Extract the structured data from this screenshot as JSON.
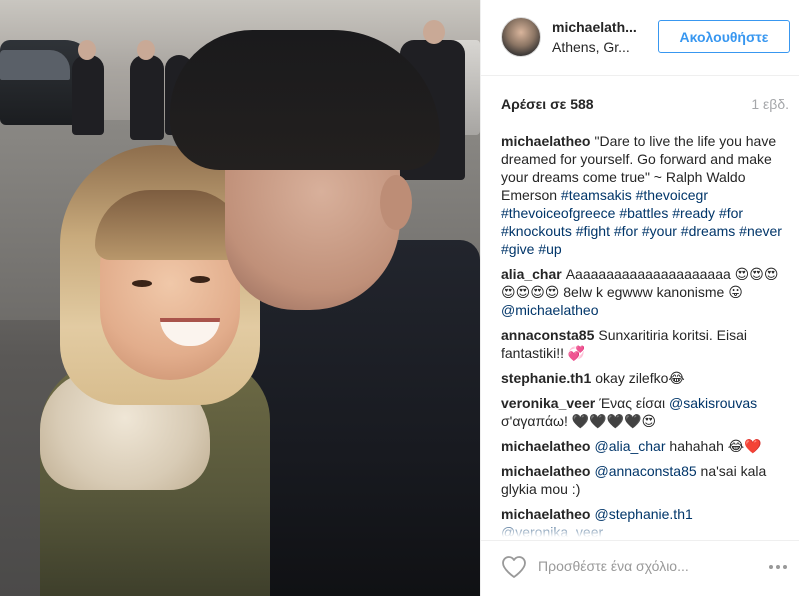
{
  "header": {
    "username": "michaelath...",
    "location": "Athens, Gr...",
    "follow_label": "Ακολουθήστε"
  },
  "stats": {
    "likes": "Αρέσει σε 588",
    "time": "1 εβδ."
  },
  "comments": [
    {
      "user": "michaelatheo",
      "parts": [
        {
          "t": "text",
          "v": "\"Dare to live the life you have dreamed for yourself. Go forward and make your dreams come true\" ~ Ralph Waldo Emerson "
        },
        {
          "t": "link",
          "v": "#teamsakis"
        },
        {
          "t": "text",
          "v": " "
        },
        {
          "t": "link",
          "v": "#thevoicegr"
        },
        {
          "t": "text",
          "v": " "
        },
        {
          "t": "link",
          "v": "#thevoiceofgreece"
        },
        {
          "t": "text",
          "v": " "
        },
        {
          "t": "link",
          "v": "#battles"
        },
        {
          "t": "text",
          "v": " "
        },
        {
          "t": "link",
          "v": "#ready"
        },
        {
          "t": "text",
          "v": " "
        },
        {
          "t": "link",
          "v": "#for"
        },
        {
          "t": "text",
          "v": " "
        },
        {
          "t": "link",
          "v": "#knockouts"
        },
        {
          "t": "text",
          "v": " "
        },
        {
          "t": "link",
          "v": "#fight"
        },
        {
          "t": "text",
          "v": " "
        },
        {
          "t": "link",
          "v": "#for"
        },
        {
          "t": "text",
          "v": " "
        },
        {
          "t": "link",
          "v": "#your"
        },
        {
          "t": "text",
          "v": " "
        },
        {
          "t": "link",
          "v": "#dreams"
        },
        {
          "t": "text",
          "v": " "
        },
        {
          "t": "link",
          "v": "#never"
        },
        {
          "t": "text",
          "v": " "
        },
        {
          "t": "link",
          "v": "#give"
        },
        {
          "t": "text",
          "v": " "
        },
        {
          "t": "link",
          "v": "#up"
        }
      ]
    },
    {
      "user": "alia_char",
      "parts": [
        {
          "t": "text",
          "v": "Aaaaaaaaaaaaaaaaaaaaa 😍😍😍😍😍😍😍 8elw k egwww kanonisme 😛 "
        },
        {
          "t": "link",
          "v": "@michaelatheo"
        }
      ]
    },
    {
      "user": "annaconsta85",
      "parts": [
        {
          "t": "text",
          "v": "Sunxaritiria koritsi. Eisai fantastiki!! 💞"
        }
      ]
    },
    {
      "user": "stephanie.th1",
      "parts": [
        {
          "t": "text",
          "v": "okay zilefko😂"
        }
      ]
    },
    {
      "user": "veronika_veer",
      "parts": [
        {
          "t": "text",
          "v": "Ένας είσαι "
        },
        {
          "t": "link",
          "v": "@sakisrouvas"
        },
        {
          "t": "text",
          "v": " σ'αγαπάω! 🖤🖤🖤🖤😍"
        }
      ]
    },
    {
      "user": "michaelatheo",
      "parts": [
        {
          "t": "link",
          "v": "@alia_char"
        },
        {
          "t": "text",
          "v": " hahahah 😂❤️"
        }
      ]
    },
    {
      "user": "michaelatheo",
      "parts": [
        {
          "t": "link",
          "v": "@annaconsta85"
        },
        {
          "t": "text",
          "v": " na'sai kala glykia mou :)"
        }
      ]
    },
    {
      "user": "michaelatheo",
      "parts": [
        {
          "t": "link",
          "v": "@stephanie.th1"
        },
        {
          "t": "text",
          "v": " "
        },
        {
          "t": "link",
          "v": "@veronika_veer"
        }
      ]
    }
  ],
  "footer": {
    "comment_placeholder": "Προσθέστε ένα σχόλιο...",
    "like_icon": "heart-outline-icon",
    "more_icon": "ellipsis-icon"
  },
  "colors": {
    "accent": "#3897f0",
    "link": "#003569",
    "muted": "#a5a7aa",
    "text": "#262626",
    "border": "#efefef"
  }
}
